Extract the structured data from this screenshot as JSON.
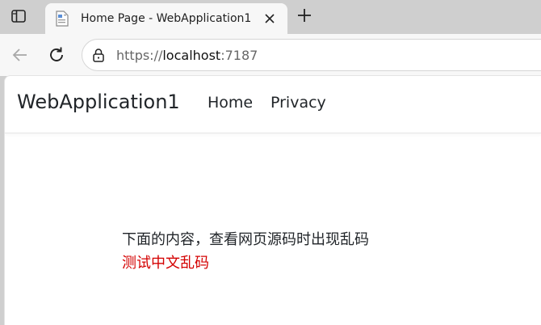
{
  "browser": {
    "tab": {
      "title": "Home Page - WebApplication1"
    },
    "address": {
      "url_scheme": "https://",
      "url_host": "localhost",
      "url_port": ":7187"
    }
  },
  "page": {
    "brand": "WebApplication1",
    "nav": [
      {
        "label": "Home"
      },
      {
        "label": "Privacy"
      }
    ],
    "content": {
      "line1": "下面的内容，查看网页源码时出现乱码",
      "line2": "测试中文乱码",
      "line2_color": "#d40000"
    }
  },
  "icons": {
    "sidebar": "sidebar-icon",
    "favicon": "document-icon",
    "close": "close-icon",
    "new_tab": "plus-icon",
    "back": "back-arrow-icon",
    "reload": "reload-icon",
    "site_info": "lock-icon"
  }
}
